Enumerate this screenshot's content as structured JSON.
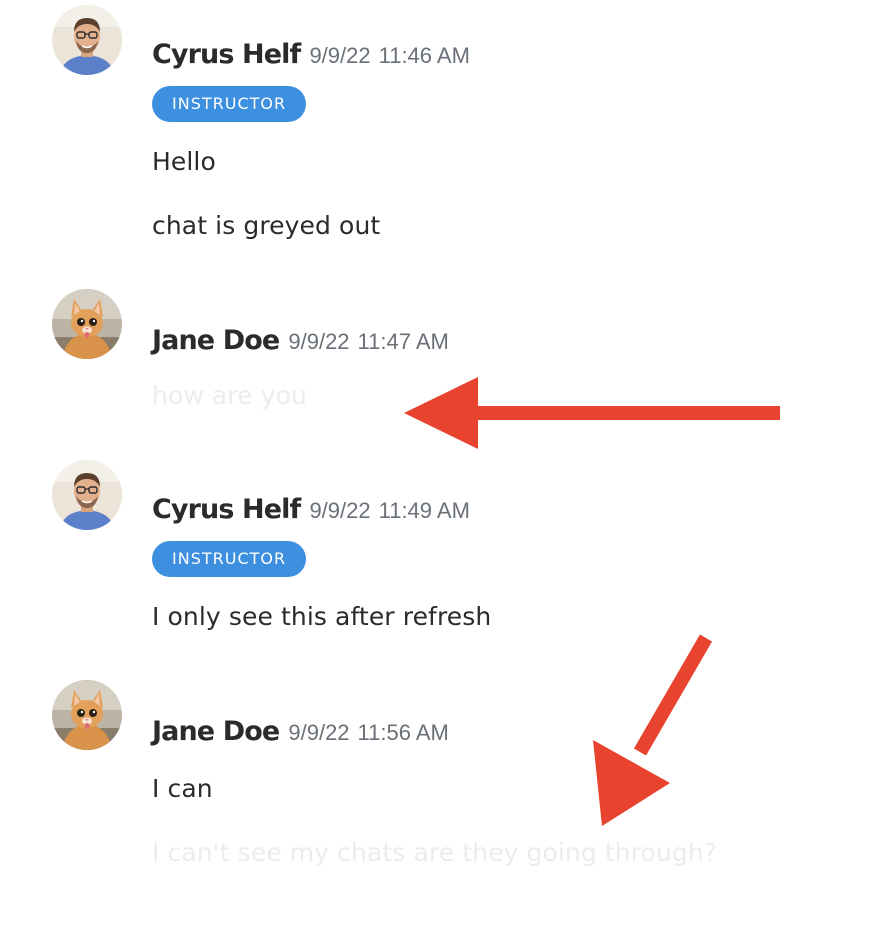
{
  "badge_label": "INSTRUCTOR",
  "accent_color": "#3d8fe0",
  "annotation_color": "#e8432e",
  "messages": [
    {
      "author": "Cyrus Helf",
      "date": "9/9/22",
      "time": "11:46 AM",
      "avatar": "man-with-glasses-avatar",
      "lines": [
        {
          "text": "Hello",
          "state": "sent"
        },
        {
          "text": "chat is greyed out",
          "state": "sent"
        }
      ]
    },
    {
      "author": "Jane Doe",
      "date": "9/9/22",
      "time": "11:47 AM",
      "avatar": "orange-kitten-avatar",
      "lines": [
        {
          "text": "how are you",
          "state": "pending"
        }
      ]
    },
    {
      "author": "Cyrus Helf",
      "date": "9/9/22",
      "time": "11:49 AM",
      "avatar": "man-with-glasses-avatar",
      "lines": [
        {
          "text": "I only see this after refresh",
          "state": "sent"
        }
      ]
    },
    {
      "author": "Jane Doe",
      "date": "9/9/22",
      "time": "11:56 AM",
      "avatar": "orange-kitten-avatar",
      "lines": [
        {
          "text": "I can",
          "state": "sent"
        },
        {
          "text": "I can't see my chats are they going through?",
          "state": "pending"
        }
      ]
    }
  ]
}
